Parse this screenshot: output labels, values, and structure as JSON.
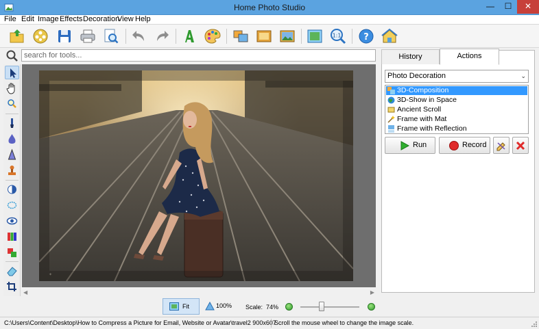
{
  "window": {
    "title": "Home Photo Studio",
    "min_glyph": "—",
    "max_glyph": "☐",
    "close_glyph": "✕"
  },
  "menu": [
    {
      "label": "File",
      "accel_char": "F"
    },
    {
      "label": "Edit"
    },
    {
      "label": "Image"
    },
    {
      "label": "Effects"
    },
    {
      "label": "Decoration"
    },
    {
      "label": "View"
    },
    {
      "label": "Help"
    }
  ],
  "toolbar": {
    "icons": [
      "open-folder-icon",
      "film-reel-icon",
      "save-disk-icon",
      "printer-icon",
      "scan-preview-icon",
      "undo-icon",
      "redo-icon",
      "text-icon",
      "palette-icon",
      "collage-icon",
      "frame-icon",
      "photo-icon",
      "fit-to-window-icon",
      "actual-size-icon",
      "help-icon",
      "home-icon"
    ]
  },
  "search": {
    "placeholder": "search for tools..."
  },
  "left_tools": [
    "pointer-arrow-icon",
    "hand-pan-icon",
    "zoom-icon",
    "brush-icon",
    "drop-icon",
    "cone-icon",
    "stamp-icon",
    "contrast-icon",
    "ellipse-select-icon",
    "eye-icon",
    "color-balance-icon",
    "layers-icon",
    "eraser-icon",
    "crop-icon"
  ],
  "tabs": {
    "history": "History",
    "actions": "Actions"
  },
  "actions_panel": {
    "category": "Photo Decoration",
    "items": [
      {
        "label": "3D-Composition",
        "selected": true
      },
      {
        "label": "3D-Show in Space",
        "selected": false
      },
      {
        "label": "Ancient Scroll",
        "selected": false
      },
      {
        "label": "Frame with Mat",
        "selected": false
      },
      {
        "label": "Frame with Reflection",
        "selected": false
      }
    ],
    "run_label": "Run",
    "record_label": "Record"
  },
  "zoom": {
    "fit_label": "Fit",
    "hundred_label": "100%",
    "scale_label": "Scale:",
    "scale_value": "74%",
    "slider_fraction": 0.35
  },
  "status": {
    "path": "C:\\Users\\Content\\Desktop\\How to Compress a Picture for Email, Website or Avatar\\travel2 900x607",
    "hint": "Scroll the mouse wheel to change the image scale."
  },
  "colors": {
    "titlebar": "#5ba3e0",
    "selection": "#3399ff",
    "close_button": "#c7403a",
    "accent_green": "#2e9a2a"
  }
}
